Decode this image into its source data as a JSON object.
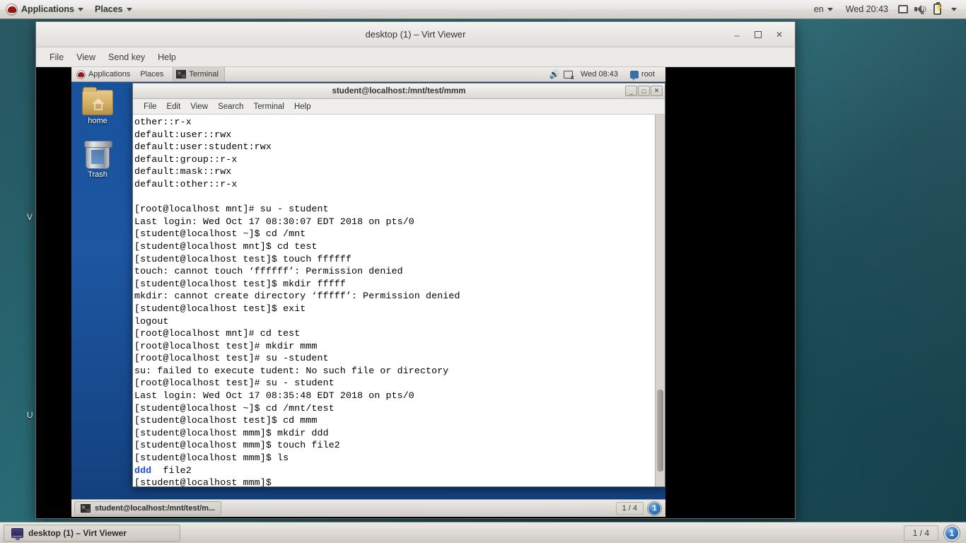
{
  "host_panel": {
    "logo": "redhat-logo",
    "applications_label": "Applications",
    "places_label": "Places",
    "keyboard_layout": "en",
    "clock": "Wed 20:43",
    "tray": [
      "display-icon",
      "speaker-muted-icon",
      "battery-charging-icon"
    ]
  },
  "host_desktop": {
    "icon_labels": [
      "V",
      "U"
    ]
  },
  "virt_viewer": {
    "title": "desktop (1) – Virt Viewer",
    "menu": [
      "File",
      "View",
      "Send key",
      "Help"
    ],
    "window_buttons": [
      "minimize",
      "maximize",
      "close"
    ]
  },
  "vm_panel": {
    "applications_label": "Applications",
    "places_label": "Places",
    "active_window_label": "Terminal",
    "clock": "Wed 08:43",
    "user": "root",
    "tray": [
      "speaker-icon",
      "network-disconnected-icon"
    ]
  },
  "vm_desktop": {
    "icons": [
      {
        "label": "home",
        "icon": "home-folder-icon"
      },
      {
        "label": "Trash",
        "icon": "trash-icon"
      }
    ]
  },
  "vm_bottom_panel": {
    "task_label": "student@localhost:/mnt/test/m...",
    "workspace_indicator": "1 / 4",
    "badge": "1"
  },
  "terminal": {
    "title": "student@localhost:/mnt/test/mmm",
    "menu": [
      "File",
      "Edit",
      "View",
      "Search",
      "Terminal",
      "Help"
    ],
    "window_buttons": [
      "minimize",
      "maximize",
      "close"
    ],
    "lines": [
      {
        "text": "other::r-x"
      },
      {
        "text": "default:user::rwx"
      },
      {
        "text": "default:user:student:rwx"
      },
      {
        "text": "default:group::r-x"
      },
      {
        "text": "default:mask::rwx"
      },
      {
        "text": "default:other::r-x"
      },
      {
        "text": ""
      },
      {
        "text": "[root@localhost mnt]# su - student"
      },
      {
        "text": "Last login: Wed Oct 17 08:30:07 EDT 2018 on pts/0"
      },
      {
        "text": "[student@localhost ~]$ cd /mnt"
      },
      {
        "text": "[student@localhost mnt]$ cd test"
      },
      {
        "text": "[student@localhost test]$ touch ffffff"
      },
      {
        "text": "touch: cannot touch ‘ffffff’: Permission denied"
      },
      {
        "text": "[student@localhost test]$ mkdir fffff"
      },
      {
        "text": "mkdir: cannot create directory ‘fffff’: Permission denied"
      },
      {
        "text": "[student@localhost test]$ exit"
      },
      {
        "text": "logout"
      },
      {
        "text": "[root@localhost mnt]# cd test"
      },
      {
        "text": "[root@localhost test]# mkdir mmm"
      },
      {
        "text": "[root@localhost test]# su -student"
      },
      {
        "text": "su: failed to execute tudent: No such file or directory"
      },
      {
        "text": "[root@localhost test]# su - student"
      },
      {
        "text": "Last login: Wed Oct 17 08:35:48 EDT 2018 on pts/0"
      },
      {
        "text": "[student@localhost ~]$ cd /mnt/test"
      },
      {
        "text": "[student@localhost test]$ cd mmm"
      },
      {
        "text": "[student@localhost mmm]$ mkdir ddd"
      },
      {
        "text": "[student@localhost mmm]$ touch file2"
      },
      {
        "text": "[student@localhost mmm]$ ls"
      },
      {
        "text": "ddd  file2",
        "dir_prefix": "ddd"
      },
      {
        "text": "[student@localhost mmm]$ "
      }
    ]
  },
  "host_bottom_panel": {
    "task_label": "desktop (1) – Virt Viewer",
    "workspace_indicator": "1 / 4",
    "badge": "1"
  },
  "colors": {
    "vm_wallpaper": "#18529c",
    "host_wallpaper": "#256b77",
    "terminal_bg": "#ffffff",
    "terminal_fg": "#000000",
    "dir_color": "#1f4fd8"
  }
}
